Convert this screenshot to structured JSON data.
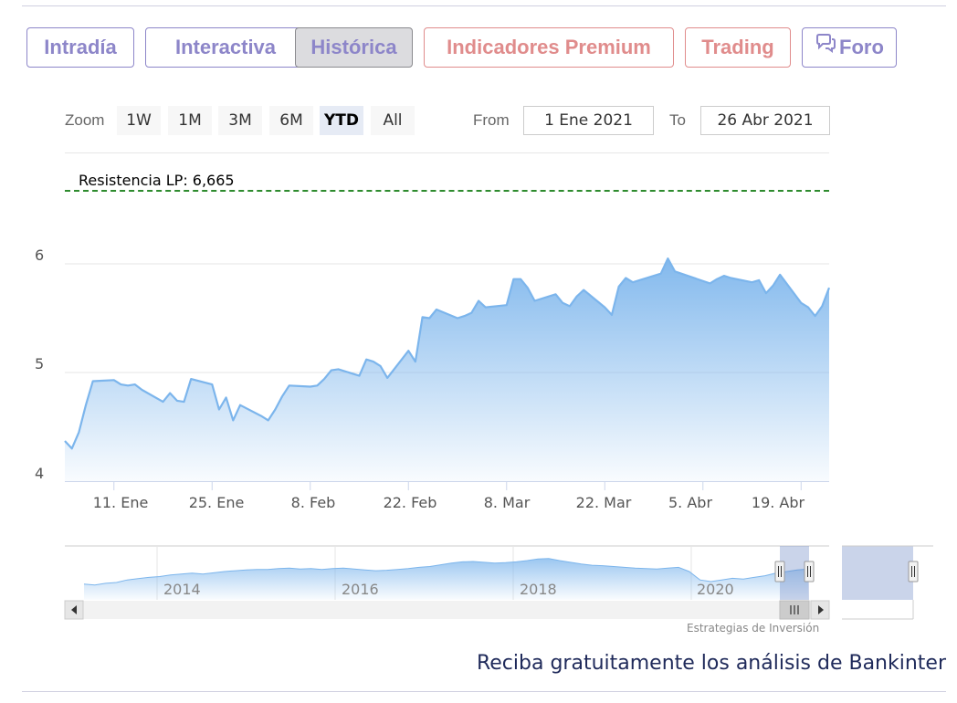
{
  "tabs": [
    {
      "label": "Intradía"
    },
    {
      "label": "Interactiva"
    },
    {
      "label": "Histórica"
    },
    {
      "label": "Indicadores Premium"
    },
    {
      "label": "Trading"
    },
    {
      "label": "Foro",
      "icon": "chat-bubbles-icon"
    }
  ],
  "range_selector": {
    "zoom_label": "Zoom",
    "buttons": [
      "1W",
      "1M",
      "3M",
      "6M",
      "YTD",
      "All"
    ],
    "selected": "YTD",
    "from_label": "From",
    "from_value": "1 Ene 2021",
    "to_label": "To",
    "to_value": "26 Abr 2021"
  },
  "resistance": {
    "label": "Resistencia LP: 6,665",
    "value": 6.665,
    "color": "#2e8b2e"
  },
  "colors": {
    "accent": "#8d86c9",
    "premium": "#e08c8c",
    "series": "#7cb5ec",
    "promo": "#1f2a5a"
  },
  "chart_data": {
    "type": "area",
    "y_ticks": [
      "4",
      "5",
      "6"
    ],
    "ylim": [
      4,
      7
    ],
    "x_ticks": [
      "11. Ene",
      "25. Ene",
      "8. Feb",
      "22. Feb",
      "8. Mar",
      "22. Mar",
      "5. Abr",
      "19. Abr"
    ],
    "series": [
      {
        "points": [
          [
            "2021-01-04",
            4.37
          ],
          [
            "2021-01-05",
            4.3
          ],
          [
            "2021-01-06",
            4.45
          ],
          [
            "2021-01-07",
            4.7
          ],
          [
            "2021-01-08",
            4.92
          ],
          [
            "2021-01-11",
            4.93
          ],
          [
            "2021-01-12",
            4.89
          ],
          [
            "2021-01-13",
            4.88
          ],
          [
            "2021-01-14",
            4.89
          ],
          [
            "2021-01-15",
            4.84
          ],
          [
            "2021-01-18",
            4.73
          ],
          [
            "2021-01-19",
            4.81
          ],
          [
            "2021-01-20",
            4.74
          ],
          [
            "2021-01-21",
            4.73
          ],
          [
            "2021-01-22",
            4.94
          ],
          [
            "2021-01-25",
            4.89
          ],
          [
            "2021-01-26",
            4.66
          ],
          [
            "2021-01-27",
            4.77
          ],
          [
            "2021-01-28",
            4.56
          ],
          [
            "2021-01-29",
            4.7
          ],
          [
            "2021-02-01",
            4.6
          ],
          [
            "2021-02-02",
            4.56
          ],
          [
            "2021-02-03",
            4.66
          ],
          [
            "2021-02-04",
            4.78
          ],
          [
            "2021-02-05",
            4.88
          ],
          [
            "2021-02-08",
            4.87
          ],
          [
            "2021-02-09",
            4.88
          ],
          [
            "2021-02-10",
            4.94
          ],
          [
            "2021-02-11",
            5.02
          ],
          [
            "2021-02-12",
            5.03
          ],
          [
            "2021-02-15",
            4.97
          ],
          [
            "2021-02-16",
            5.12
          ],
          [
            "2021-02-17",
            5.1
          ],
          [
            "2021-02-18",
            5.06
          ],
          [
            "2021-02-19",
            4.95
          ],
          [
            "2021-02-22",
            5.2
          ],
          [
            "2021-02-23",
            5.1
          ],
          [
            "2021-02-24",
            5.51
          ],
          [
            "2021-02-25",
            5.5
          ],
          [
            "2021-02-26",
            5.58
          ],
          [
            "2021-03-01",
            5.5
          ],
          [
            "2021-03-02",
            5.52
          ],
          [
            "2021-03-03",
            5.55
          ],
          [
            "2021-03-04",
            5.66
          ],
          [
            "2021-03-05",
            5.6
          ],
          [
            "2021-03-08",
            5.62
          ],
          [
            "2021-03-09",
            5.86
          ],
          [
            "2021-03-10",
            5.86
          ],
          [
            "2021-03-11",
            5.78
          ],
          [
            "2021-03-12",
            5.66
          ],
          [
            "2021-03-15",
            5.72
          ],
          [
            "2021-03-16",
            5.64
          ],
          [
            "2021-03-17",
            5.61
          ],
          [
            "2021-03-18",
            5.7
          ],
          [
            "2021-03-19",
            5.76
          ],
          [
            "2021-03-22",
            5.6
          ],
          [
            "2021-03-23",
            5.53
          ],
          [
            "2021-03-24",
            5.79
          ],
          [
            "2021-03-25",
            5.87
          ],
          [
            "2021-03-26",
            5.83
          ],
          [
            "2021-03-29",
            5.89
          ],
          [
            "2021-03-30",
            5.91
          ],
          [
            "2021-03-31",
            6.05
          ],
          [
            "2021-04-01",
            5.93
          ],
          [
            "2021-04-06",
            5.82
          ],
          [
            "2021-04-07",
            5.86
          ],
          [
            "2021-04-08",
            5.89
          ],
          [
            "2021-04-09",
            5.87
          ],
          [
            "2021-04-12",
            5.83
          ],
          [
            "2021-04-13",
            5.85
          ],
          [
            "2021-04-14",
            5.73
          ],
          [
            "2021-04-15",
            5.8
          ],
          [
            "2021-04-16",
            5.9
          ],
          [
            "2021-04-19",
            5.64
          ],
          [
            "2021-04-20",
            5.6
          ],
          [
            "2021-04-21",
            5.52
          ],
          [
            "2021-04-22",
            5.61
          ],
          [
            "2021-04-23",
            5.78
          ]
        ]
      }
    ]
  },
  "navigator": {
    "years": [
      "2014",
      "2016",
      "2018",
      "2020"
    ],
    "profile": [
      0.2,
      0.18,
      0.22,
      0.24,
      0.3,
      0.33,
      0.36,
      0.38,
      0.42,
      0.44,
      0.46,
      0.44,
      0.47,
      0.5,
      0.52,
      0.54,
      0.55,
      0.55,
      0.57,
      0.58,
      0.56,
      0.57,
      0.55,
      0.57,
      0.58,
      0.56,
      0.54,
      0.52,
      0.53,
      0.55,
      0.57,
      0.6,
      0.62,
      0.66,
      0.7,
      0.73,
      0.74,
      0.72,
      0.7,
      0.71,
      0.73,
      0.76,
      0.8,
      0.81,
      0.76,
      0.72,
      0.68,
      0.65,
      0.64,
      0.62,
      0.6,
      0.58,
      0.57,
      0.56,
      0.58,
      0.6,
      0.5,
      0.3,
      0.26,
      0.3,
      0.34,
      0.32,
      0.36,
      0.4,
      0.46,
      0.5,
      0.54,
      0.56
    ]
  },
  "credits": "Estrategias de Inversión",
  "promo": "Reciba gratuitamente los análisis de Bankinter"
}
